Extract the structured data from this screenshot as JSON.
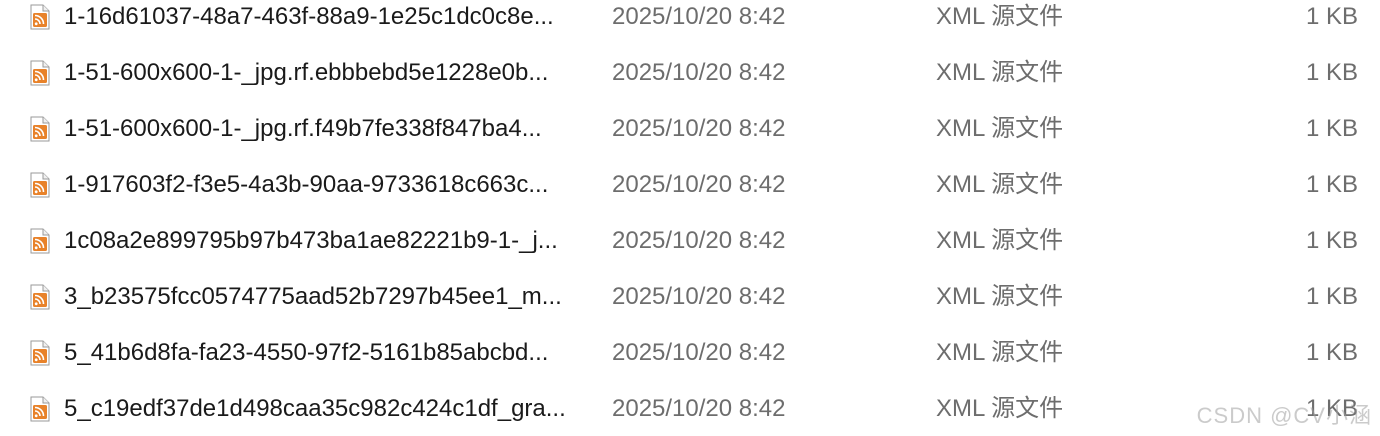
{
  "files": [
    {
      "name": "1-16d61037-48a7-463f-88a9-1e25c1dc0c8e...",
      "date": "2025/10/20 8:42",
      "type": "XML 源文件",
      "size": "1 KB",
      "icon": "rss-xml-file-icon"
    },
    {
      "name": "1-51-600x600-1-_jpg.rf.ebbbebd5e1228e0b...",
      "date": "2025/10/20 8:42",
      "type": "XML 源文件",
      "size": "1 KB",
      "icon": "rss-xml-file-icon"
    },
    {
      "name": "1-51-600x600-1-_jpg.rf.f49b7fe338f847ba4...",
      "date": "2025/10/20 8:42",
      "type": "XML 源文件",
      "size": "1 KB",
      "icon": "rss-xml-file-icon"
    },
    {
      "name": "1-917603f2-f3e5-4a3b-90aa-9733618c663c...",
      "date": "2025/10/20 8:42",
      "type": "XML 源文件",
      "size": "1 KB",
      "icon": "rss-xml-file-icon"
    },
    {
      "name": "1c08a2e899795b97b473ba1ae82221b9-1-_j...",
      "date": "2025/10/20 8:42",
      "type": "XML 源文件",
      "size": "1 KB",
      "icon": "rss-xml-file-icon"
    },
    {
      "name": "3_b23575fcc0574775aad52b7297b45ee1_m...",
      "date": "2025/10/20 8:42",
      "type": "XML 源文件",
      "size": "1 KB",
      "icon": "rss-xml-file-icon"
    },
    {
      "name": "5_41b6d8fa-fa23-4550-97f2-5161b85abcbd...",
      "date": "2025/10/20 8:42",
      "type": "XML 源文件",
      "size": "1 KB",
      "icon": "rss-xml-file-icon"
    },
    {
      "name": "5_c19edf37de1d498caa35c982c424c1df_gra...",
      "date": "2025/10/20 8:42",
      "type": "XML 源文件",
      "size": "1 KB",
      "icon": "rss-xml-file-icon"
    }
  ],
  "watermark": "CSDN @CV小涵",
  "colors": {
    "icon_orange": "#e8822a",
    "text_primary": "#1a1a1a",
    "text_secondary": "#6d6d6d"
  }
}
